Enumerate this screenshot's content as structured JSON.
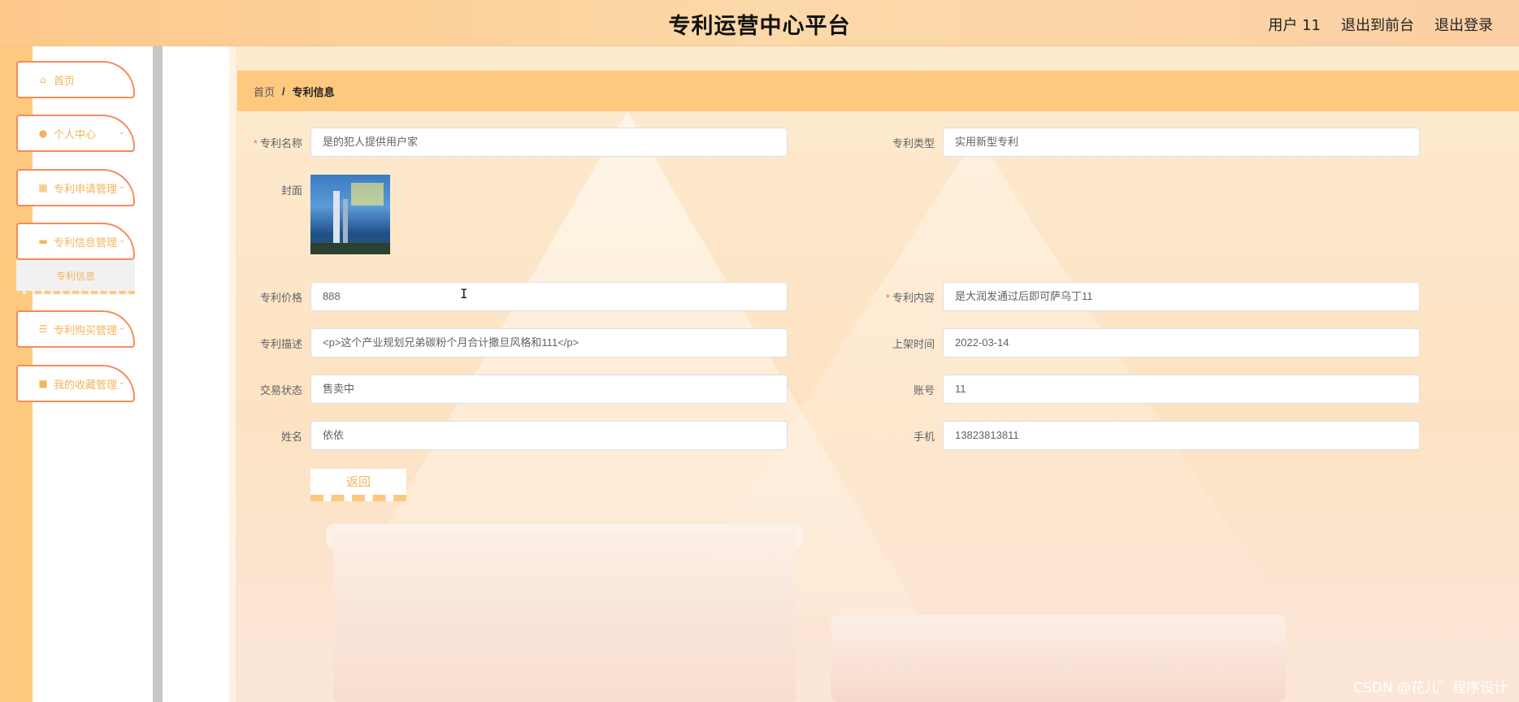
{
  "header": {
    "title": "专利运营中心平台",
    "user_label": "用户 11",
    "to_front_label": "退出到前台",
    "logout_label": "退出登录"
  },
  "sidebar": {
    "items": [
      {
        "label": "首页",
        "icon": "home-icon",
        "has_chevron": false
      },
      {
        "label": "个人中心",
        "icon": "user-icon",
        "has_chevron": true
      },
      {
        "label": "专利申请管理",
        "icon": "grid-icon",
        "has_chevron": true
      },
      {
        "label": "专利信息管理",
        "icon": "briefcase-icon",
        "has_chevron": true
      },
      {
        "label": "专利购买管理",
        "icon": "sliders-icon",
        "has_chevron": true
      },
      {
        "label": "我的收藏管理",
        "icon": "bookmark-icon",
        "has_chevron": true
      }
    ],
    "submenu_label": "专利信息"
  },
  "breadcrumb": {
    "home": "首页",
    "separator": "/",
    "current": "专利信息"
  },
  "form": {
    "patent_name": {
      "label": "专利名称",
      "value": "是的犯人提供用户家",
      "required": true
    },
    "patent_type": {
      "label": "专利类型",
      "value": "实用新型专利"
    },
    "cover": {
      "label": "封面"
    },
    "price": {
      "label": "专利价格",
      "value": "888"
    },
    "content": {
      "label": "专利内容",
      "value": "是大润发通过后即可萨乌丁11",
      "required": true
    },
    "description": {
      "label": "专利描述",
      "value": "<p>这个产业规划兄弟碳粉个月合计撒旦风格和111</p>"
    },
    "shelf_time": {
      "label": "上架时间",
      "value": "2022-03-14"
    },
    "trade_status": {
      "label": "交易状态",
      "value": "售卖中"
    },
    "account": {
      "label": "账号",
      "value": "11"
    },
    "name": {
      "label": "姓名",
      "value": "依依"
    },
    "phone": {
      "label": "手机",
      "value": "13823813811"
    },
    "back_label": "返回",
    "required_mark": "*"
  },
  "watermark": "CSDN @花儿゛程序设计",
  "colors": {
    "accent": "#fdc97f",
    "menu_border": "#f28c5a",
    "menu_text": "#f4b45a",
    "required": "#f56c6c"
  }
}
